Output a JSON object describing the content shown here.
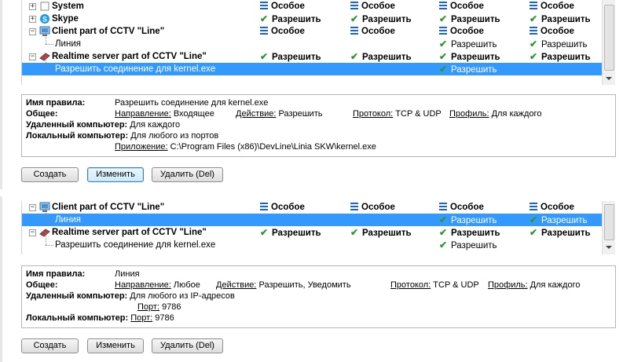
{
  "colors": {
    "selection": "#3399ff",
    "check": "#2b9a2b",
    "custom_icon": "#1f63c6"
  },
  "panel1": {
    "rows": [
      {
        "name": "System",
        "toggle": "+",
        "icon": "system-icon",
        "cols": [
          {
            "t": "Особое",
            "k": "eq"
          },
          {
            "t": "Особое",
            "k": "eq"
          },
          {
            "t": "Особое",
            "k": "eq"
          },
          {
            "t": "Особое",
            "k": "eq"
          }
        ]
      },
      {
        "name": "Skype",
        "toggle": "+",
        "icon": "skype-icon",
        "cols": [
          {
            "t": "Разрешить",
            "k": "ck"
          },
          {
            "t": "Разрешить",
            "k": "ck"
          },
          {
            "t": "Разрешить",
            "k": "ck"
          },
          {
            "t": "Разрешить",
            "k": "ck"
          }
        ]
      },
      {
        "name": "Client part of CCTV \"Line\"",
        "toggle": "−",
        "icon": "computer-icon",
        "cols": [
          {
            "t": "Особое",
            "k": "eq"
          },
          {
            "t": "Особое",
            "k": "eq"
          },
          {
            "t": "Особое",
            "k": "eq"
          },
          {
            "t": "Особое",
            "k": "eq"
          }
        ]
      },
      {
        "name": "Линия",
        "child": true,
        "cols": [
          null,
          null,
          {
            "t": "Разрешить",
            "k": "ck"
          },
          {
            "t": "Разрешить",
            "k": "ck"
          }
        ]
      },
      {
        "name": "Realtime server part of CCTV \"Line\"",
        "toggle": "−",
        "icon": "server-icon",
        "cols": [
          {
            "t": "Разрешить",
            "k": "ck"
          },
          {
            "t": "Разрешить",
            "k": "ck"
          },
          {
            "t": "Разрешить",
            "k": "ck"
          },
          {
            "t": "Разрешить",
            "k": "ck"
          }
        ]
      },
      {
        "name": "Разрешить соединение для kernel.exe",
        "child": true,
        "selected": true,
        "cols": [
          null,
          null,
          {
            "t": "Разрешить",
            "k": "ck"
          },
          null
        ]
      }
    ],
    "details": {
      "rule_name_label": "Имя правила:",
      "rule_name": "Разрешить соединение для kernel.exe",
      "general_label": "Общее:",
      "direction_label": "Направление:",
      "direction": "Входящее",
      "action_label": "Действие:",
      "action": "Разрешить",
      "protocol_label": "Протокол:",
      "protocol": "TCP & UDP",
      "profile_label": "Профиль:",
      "profile": "Для каждого",
      "remote_label": "Удаленный компьютер:",
      "remote": "Для каждого",
      "local_label": "Локальный компьютер:",
      "local": "Для любого из портов",
      "app_label": "Приложение:",
      "app": "C:\\Program Files (x86)\\DevLine\\Linia SKW\\kernel.exe"
    },
    "buttons": {
      "create": "Создать",
      "edit": "Изменить",
      "delete": "Удалить (Del)"
    }
  },
  "panel2": {
    "rows": [
      {
        "name": "Client part of CCTV \"Line\"",
        "toggle": "−",
        "icon": "computer-icon",
        "cols": [
          {
            "t": "Особое",
            "k": "eq"
          },
          {
            "t": "Особое",
            "k": "eq"
          },
          {
            "t": "Особое",
            "k": "eq"
          },
          {
            "t": "Особое",
            "k": "eq"
          }
        ]
      },
      {
        "name": "Линия",
        "child": true,
        "selected": true,
        "cols": [
          null,
          null,
          {
            "t": "Разрешить",
            "k": "ck"
          },
          {
            "t": "Разрешить",
            "k": "ck"
          }
        ]
      },
      {
        "name": "Realtime server part of CCTV \"Line\"",
        "toggle": "−",
        "icon": "server-icon",
        "cols": [
          {
            "t": "Разрешить",
            "k": "ck"
          },
          {
            "t": "Разрешить",
            "k": "ck"
          },
          {
            "t": "Разрешить",
            "k": "ck"
          },
          {
            "t": "Разрешить",
            "k": "ck"
          }
        ]
      },
      {
        "name": "Разрешить соединение для kernel.exe",
        "child": true,
        "cols": [
          null,
          null,
          {
            "t": "Разрешить",
            "k": "ck"
          },
          null
        ]
      }
    ],
    "details": {
      "rule_name_label": "Имя правила:",
      "rule_name": "Линия",
      "general_label": "Общее:",
      "direction_label": "Направление:",
      "direction": "Любое",
      "action_label": "Действие:",
      "action": "Разрешить, Уведомить",
      "protocol_label": "Протокол:",
      "protocol": "TCP & UDP",
      "profile_label": "Профиль:",
      "profile": "Для каждого",
      "remote_label": "Удаленный компьютер:",
      "remote": "Для любого из IP-адресов",
      "remote_port_label": "Порт:",
      "remote_port": "9786",
      "local_label": "Локальный компьютер:",
      "local_port_label": "Порт:",
      "local_port": "9786"
    },
    "buttons": {
      "create": "Создать",
      "edit": "Изменить",
      "delete": "Удалить (Del)"
    }
  }
}
